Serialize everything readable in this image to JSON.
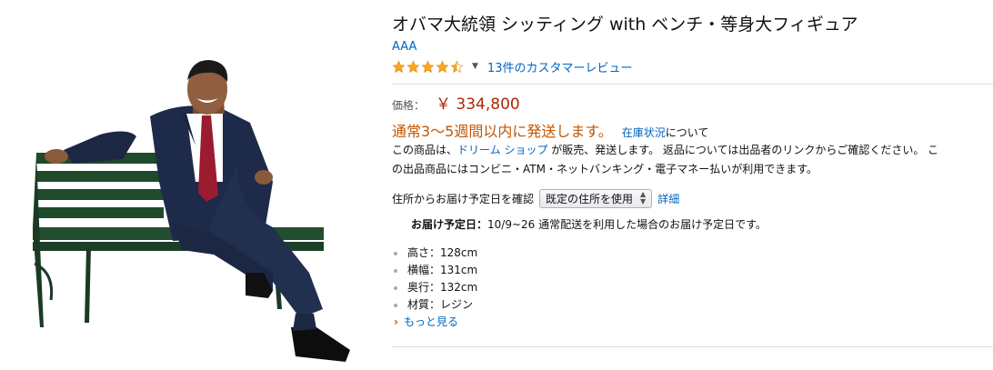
{
  "product": {
    "title": "オバマ大統領 シッティング with ベンチ・等身大フィギュア",
    "brand": "AAA",
    "rating": 4.5,
    "reviews_label": "13件のカスタマーレビュー"
  },
  "price": {
    "label": "価格：",
    "value": "￥ 334,800"
  },
  "availability": {
    "shipping": "通常3〜5週間以内に発送します。",
    "stock_link": "在庫状況",
    "stock_tail": "について"
  },
  "seller": {
    "line1_prefix": "この商品は、",
    "seller_name": "ドリーム ショップ",
    "line1_suffix": " が販売、発送します。 返品については出品者のリンクからご確認ください。 こ",
    "line2": "の出品商品にはコンビニ・ATM・ネットバンキング・電子マネー払いが利用できます。"
  },
  "address": {
    "label": "住所からお届け予定日を確認",
    "select_value": "既定の住所を使用",
    "detail_link": "詳細"
  },
  "delivery": {
    "label": "お届け予定日：",
    "text": "10/9~26 通常配送を利用した場合のお届け予定日です。"
  },
  "features": [
    "高さ：128cm",
    "横幅：131cm",
    "奥行：132cm",
    "材質：レジン"
  ],
  "more_link": "もっと見る",
  "colors": {
    "link": "#0066c0",
    "price": "#b12704",
    "shipping": "#c45500",
    "star": "#ffa41c"
  }
}
